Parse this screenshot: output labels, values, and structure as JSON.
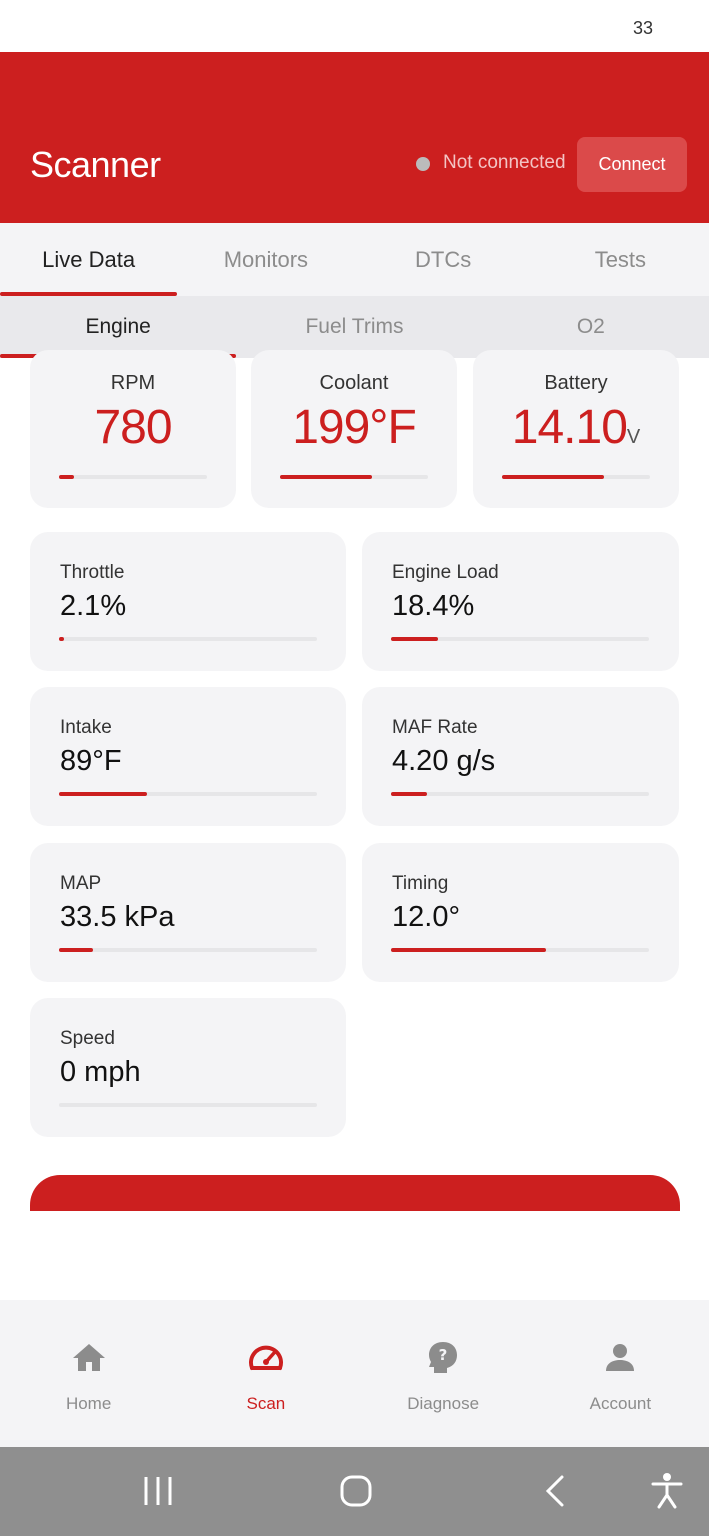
{
  "status_bar": {
    "clock": "33"
  },
  "header": {
    "title": "Scanner",
    "connection_status": "Not connected",
    "connect_label": "Connect"
  },
  "tabs": [
    {
      "label": "Live Data",
      "active": true
    },
    {
      "label": "Monitors",
      "active": false
    },
    {
      "label": "DTCs",
      "active": false
    },
    {
      "label": "Tests",
      "active": false
    }
  ],
  "subtabs": [
    {
      "label": "Engine",
      "active": true
    },
    {
      "label": "Fuel Trims",
      "active": false
    },
    {
      "label": "O2",
      "active": false
    }
  ],
  "primary_gauges": [
    {
      "label": "RPM",
      "value": "780",
      "unit": "",
      "level": 0.1
    },
    {
      "label": "Coolant",
      "value": "199°F",
      "unit": "",
      "level": 0.62
    },
    {
      "label": "Battery",
      "value": "14.10",
      "unit": "V",
      "level": 0.69
    }
  ],
  "readings": [
    {
      "label": "Throttle",
      "value": "2.1%",
      "level": 0.021
    },
    {
      "label": "Engine Load",
      "value": "18.4%",
      "level": 0.184
    },
    {
      "label": "Intake",
      "value": "89°F",
      "level": 0.34
    },
    {
      "label": "MAF Rate",
      "value": "4.20 g/s",
      "level": 0.14
    },
    {
      "label": "MAP",
      "value": "33.5 kPa",
      "level": 0.13
    },
    {
      "label": "Timing",
      "value": "12.0°",
      "level": 0.6
    },
    {
      "label": "Speed",
      "value": "0 mph",
      "level": 0
    }
  ],
  "bottom_nav": [
    {
      "label": "Home",
      "icon": "home-icon",
      "active": false
    },
    {
      "label": "Scan",
      "icon": "speedometer-icon",
      "active": true
    },
    {
      "label": "Diagnose",
      "icon": "question-head-icon",
      "active": false
    },
    {
      "label": "Account",
      "icon": "person-icon",
      "active": false
    }
  ],
  "colors": {
    "accent": "#cc1f1f",
    "card": "#f4f4f6",
    "inactive": "#8c8c8c"
  }
}
